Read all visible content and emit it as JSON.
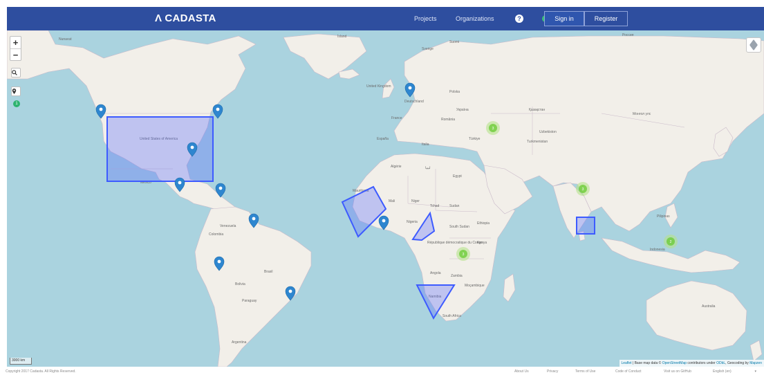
{
  "navbar": {
    "brand": "CADASTA",
    "brand_mark": "Λ",
    "links": [
      "Projects",
      "Organizations"
    ],
    "help_glyph": "?",
    "signin_label": "Sign in",
    "register_label": "Register",
    "brand_color": "#2e4e9f"
  },
  "map": {
    "zoom_in": "+",
    "zoom_out": "−",
    "search_icon": "search-icon",
    "locate_icon": "marker-icon",
    "locate_badge": "1",
    "scale_label": "3000 km",
    "attribution": {
      "prefix": "Leaflet",
      "text": " | Base map data © ",
      "osm": "OpenStreetMap",
      "text2": " contributors under ",
      "odbl": "ODbL",
      "text3": ", Geocoding by ",
      "mapzen": "Mapzen"
    },
    "place_labels": [
      "United States of America",
      "Mexico",
      "Venezuela",
      "Colombia",
      "Brasil",
      "Bolivia",
      "Paraguay",
      "Argentina",
      "Sverige",
      "Suomi",
      "United Kingdom",
      "Deutschland",
      "France",
      "España",
      "Italia",
      "Polska",
      "Україна",
      "România",
      "Türkiye",
      "Algérie",
      "ليبيا",
      "Egypt",
      "Mali",
      "Niger",
      "Tchad",
      "Sudan",
      "Nigeria",
      "South Sudan",
      "Ethiopia",
      "Kenya",
      "République démocratique du Congo",
      "Angola",
      "Zambia",
      "Namibia",
      "South Africa",
      "Moçambique",
      "Қазақстан",
      "Монгол улс",
      "Россия",
      "Pilipinas",
      "Indonesia",
      "Australia",
      "Mauritania",
      "Ísland",
      "Nunavut",
      "Uzbekiston",
      "Turkmenistan"
    ],
    "cluster_counts": [
      "3",
      "3",
      "3",
      "2"
    ],
    "marker_color": "#2e86cf",
    "polygon_color": "#3d5bff"
  },
  "footer": {
    "copyright": "Copyright 2017 Cadasta. All Rights Reserved.",
    "links": [
      "About Us",
      "Privacy",
      "Terms of Use",
      "Code of Conduct",
      "Visit us on GitHub"
    ],
    "language": "English (en)"
  }
}
